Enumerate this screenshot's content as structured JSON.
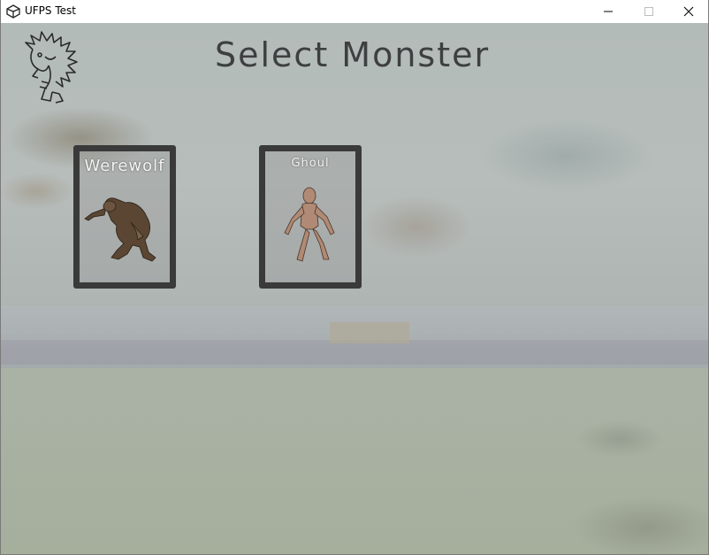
{
  "window": {
    "title": "UFPS Test",
    "controls": [
      "minimize",
      "maximize",
      "close"
    ]
  },
  "screen": {
    "title": "Select Monster",
    "logo_icon": "spiky-creature-logo-icon"
  },
  "monsters": [
    {
      "name": "Werewolf",
      "icon": "werewolf-figure"
    },
    {
      "name": "Ghoul",
      "icon": "ghoul-figure"
    }
  ],
  "colors": {
    "title_text": "#3e3f40",
    "card_border": "#3a3a3a",
    "card_label": "#f2f2f2"
  }
}
